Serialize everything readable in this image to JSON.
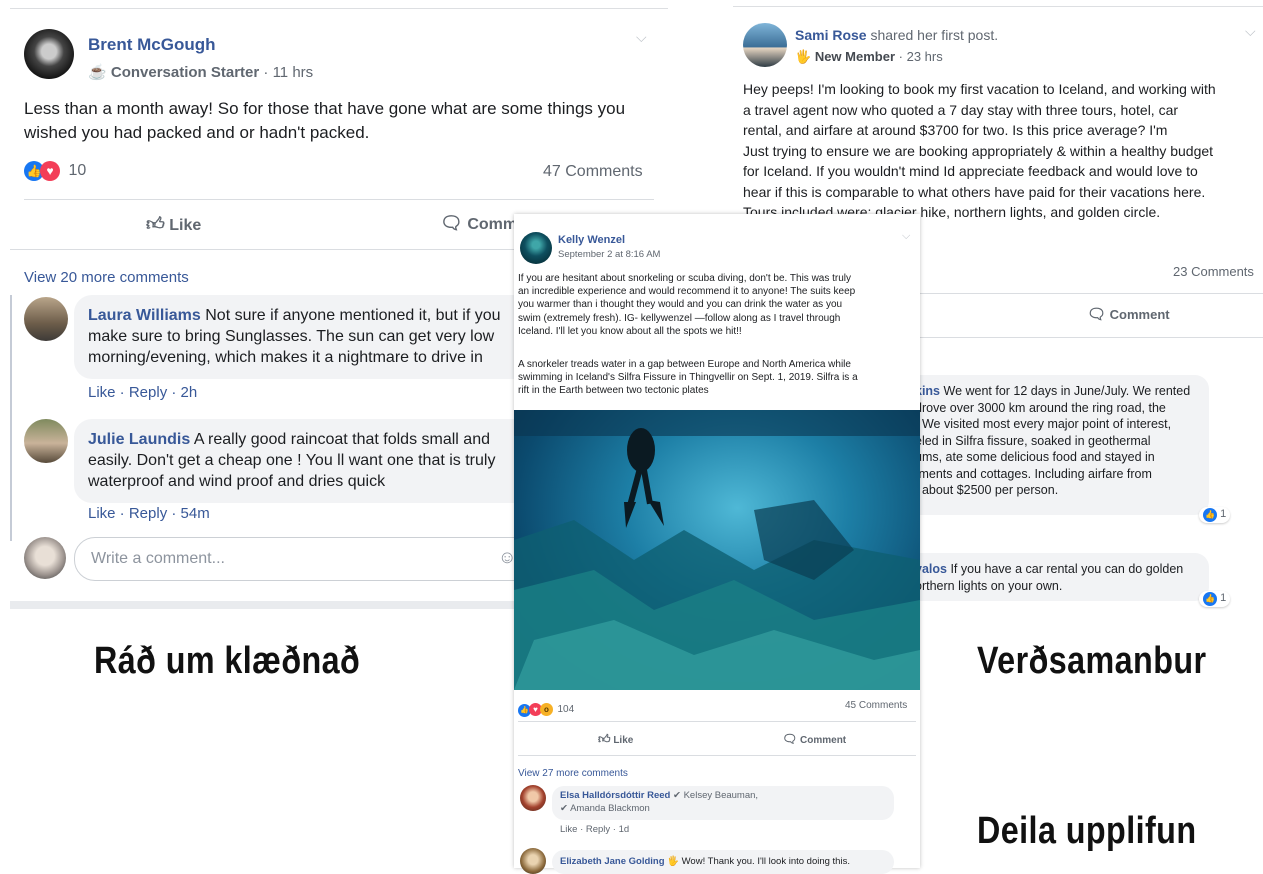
{
  "post1": {
    "author": "Brent McGough",
    "badge_icon": "coffee-icon",
    "badge": "Conversation Starter",
    "time": "11 hrs",
    "text": "Less than a month away! So for those that have gone what are some things you wished you had packed and or hadn't packed.",
    "reaction_count": "10",
    "comments_count": "47 Comments",
    "like_label": "Like",
    "comment_label": "Comment",
    "view_more": "View 20 more comments",
    "comments": [
      {
        "name": "Laura Williams",
        "text_lines": [
          "Not sure if anyone mentioned it, but if you",
          "make sure to bring Sunglasses. The sun can get very low",
          "morning/evening, which makes it a nightmare to drive in"
        ],
        "actions": "Like · Reply · 2h"
      },
      {
        "name": "Julie Laundis",
        "text_lines": [
          "A really good raincoat that folds small and",
          "easily. Don't get a cheap one ! You ll want one that is truly",
          "waterproof and wind proof and dries quick"
        ],
        "actions": "Like · Reply · 54m"
      }
    ],
    "write_placeholder": "Write a comment..."
  },
  "post2": {
    "author": "Sami Rose",
    "author_suffix": " shared her first post.",
    "badge": "New Member",
    "time": "23 hrs",
    "text_lines": [
      "Hey peeps! I'm looking to book my first vacation to Iceland, and working with",
      "a travel agent now who quoted a 7 day stay with three tours, hotel, car",
      "rental, and airfare at around $3700 for two. Is this price average? I'm",
      "Just trying to ensure we are booking appropriately & within a healthy budget",
      "for Iceland. If you wouldn't mind Id appreciate feedback and would love to",
      "hear if this is comparable to what others have paid for their vacations here.",
      "Tours included were: glacier hike, northern lights, and golden circle."
    ],
    "comments_count": "23 Comments",
    "comment_label": "Comment",
    "comment1_name": "kins",
    "comment1_lines": [
      "We went for 12 days in June/July. We rented",
      "drove over 3000 km around the ring road, the",
      ". We visited most every major point of interest,",
      "eled in Silfra fissure, soaked in geothermal",
      "ums, ate some delicious food and stayed in",
      "tments and cottages. Including airfare from",
      "t about $2500 per person."
    ],
    "comment1_likes": "1",
    "comment2_name": "yalos",
    "comment2_lines": [
      "If you have a car rental you can do golden",
      "orthern lights on your own."
    ],
    "comment2_likes": "1"
  },
  "post3": {
    "author": "Kelly Wenzel",
    "time": "September 2 at 8:16 AM",
    "text_lines": [
      "If you are hesitant about snorkeling or scuba diving, don't be. This was truly",
      "an incredible experience and would recommend it to anyone! The suits keep",
      "you warmer than i thought they would and you can drink the water as you",
      "swim (extremely fresh). IG- kellywenzel —follow along as I travel through",
      "Iceland. I'll let you know about all the spots we hit!!"
    ],
    "caption_lines": [
      "A snorkeler treads water in a gap between Europe and North America while",
      "swimming in Iceland's Silfra Fissure in Thingvellir on Sept. 1, 2019. Silfra is a",
      "rift in the Earth between two tectonic plates"
    ],
    "reaction_count": "104",
    "comments_count": "45 Comments",
    "like_label": "Like",
    "comment_label": "Comment",
    "view_more": "View 27 more comments",
    "c1_name": "Elsa Halldórsdóttir Reed",
    "c1_tag1": "Kelsey Beauman,",
    "c1_tag2": "Amanda Blackmon",
    "c1_actions": "Like · Reply · 1d",
    "c2_name": "Elizabeth Jane Golding",
    "c2_text": "Wow! Thank you. I'll look into doing this."
  },
  "captions": {
    "left": "Ráð um klæðnað",
    "right": "Verðsamanbur",
    "bottom": "Deila upplifun"
  },
  "colors": {
    "fb_blue": "#385898",
    "like_blue": "#1877f2",
    "love_red": "#f33e58"
  }
}
